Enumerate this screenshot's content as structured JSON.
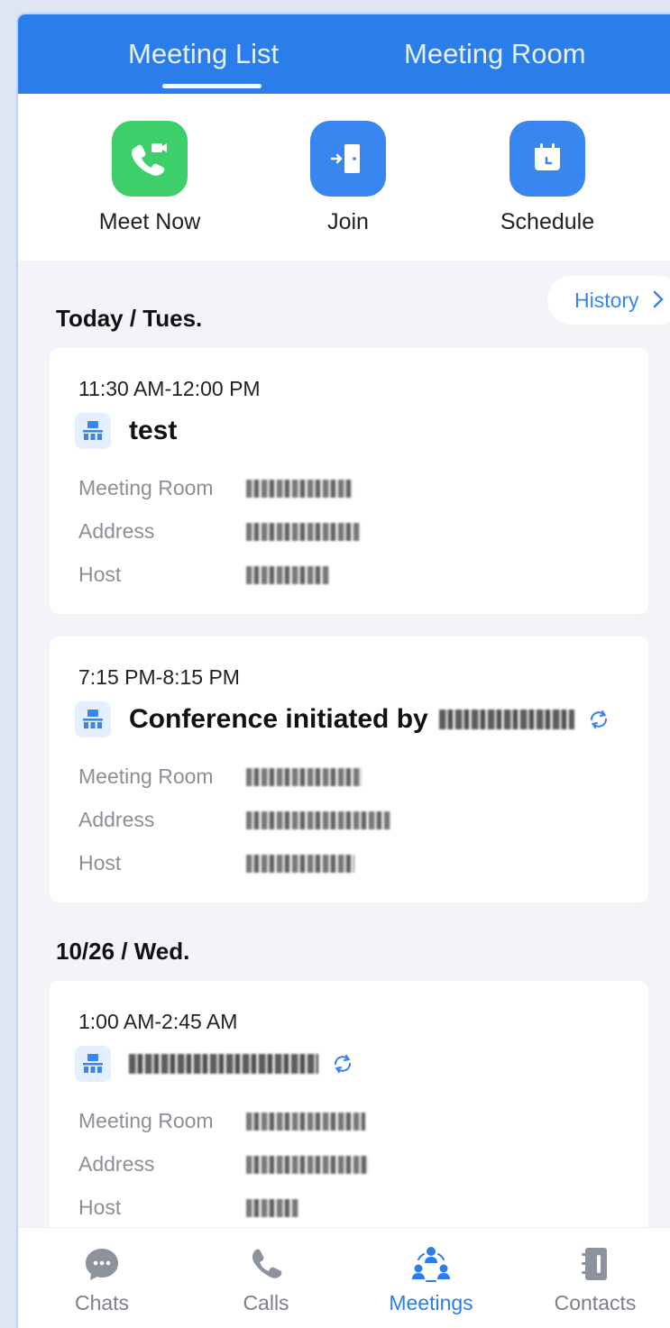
{
  "header": {
    "tabs": [
      {
        "label": "Meeting List",
        "active": true
      },
      {
        "label": "Meeting Room",
        "active": false
      }
    ]
  },
  "quick_actions": [
    {
      "label": "Meet Now",
      "icon": "phone-video-icon",
      "color": "#3ccf6a"
    },
    {
      "label": "Join",
      "icon": "door-enter-icon",
      "color": "#3a86f0"
    },
    {
      "label": "Schedule",
      "icon": "calendar-icon",
      "color": "#3a86f0"
    }
  ],
  "history": {
    "label": "History"
  },
  "sections": [
    {
      "title": "Today / Tues.",
      "meetings": [
        {
          "time": "11:30 AM-12:00 PM",
          "title": "test",
          "recurring": false,
          "fields": [
            {
              "label": "Meeting Room"
            },
            {
              "label": "Address"
            },
            {
              "label": "Host"
            }
          ]
        },
        {
          "time": "7:15 PM-8:15 PM",
          "title": "Conference initiated by",
          "recurring": true,
          "fields": [
            {
              "label": "Meeting Room"
            },
            {
              "label": "Address"
            },
            {
              "label": "Host"
            }
          ]
        }
      ]
    },
    {
      "title": "10/26 / Wed.",
      "meetings": [
        {
          "time": "1:00 AM-2:45 AM",
          "title": "",
          "recurring": true,
          "fields": [
            {
              "label": "Meeting Room"
            },
            {
              "label": "Address"
            },
            {
              "label": "Host"
            }
          ]
        }
      ]
    }
  ],
  "bottom_nav": [
    {
      "label": "Chats",
      "icon": "chat-bubble-icon",
      "active": false
    },
    {
      "label": "Calls",
      "icon": "phone-icon",
      "active": false
    },
    {
      "label": "Meetings",
      "icon": "meetings-icon",
      "active": true
    },
    {
      "label": "Contacts",
      "icon": "contacts-icon",
      "active": false
    }
  ],
  "colors": {
    "primary": "#2b7de9",
    "green": "#3ccf6a"
  }
}
